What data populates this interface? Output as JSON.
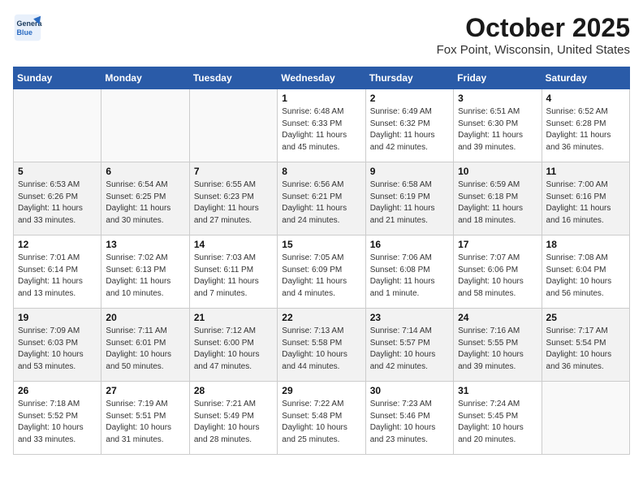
{
  "header": {
    "logo_line1": "General",
    "logo_line2": "Blue",
    "month_title": "October 2025",
    "location": "Fox Point, Wisconsin, United States"
  },
  "days_of_week": [
    "Sunday",
    "Monday",
    "Tuesday",
    "Wednesday",
    "Thursday",
    "Friday",
    "Saturday"
  ],
  "weeks": [
    [
      {
        "day": "",
        "detail": ""
      },
      {
        "day": "",
        "detail": ""
      },
      {
        "day": "",
        "detail": ""
      },
      {
        "day": "1",
        "detail": "Sunrise: 6:48 AM\nSunset: 6:33 PM\nDaylight: 11 hours\nand 45 minutes."
      },
      {
        "day": "2",
        "detail": "Sunrise: 6:49 AM\nSunset: 6:32 PM\nDaylight: 11 hours\nand 42 minutes."
      },
      {
        "day": "3",
        "detail": "Sunrise: 6:51 AM\nSunset: 6:30 PM\nDaylight: 11 hours\nand 39 minutes."
      },
      {
        "day": "4",
        "detail": "Sunrise: 6:52 AM\nSunset: 6:28 PM\nDaylight: 11 hours\nand 36 minutes."
      }
    ],
    [
      {
        "day": "5",
        "detail": "Sunrise: 6:53 AM\nSunset: 6:26 PM\nDaylight: 11 hours\nand 33 minutes."
      },
      {
        "day": "6",
        "detail": "Sunrise: 6:54 AM\nSunset: 6:25 PM\nDaylight: 11 hours\nand 30 minutes."
      },
      {
        "day": "7",
        "detail": "Sunrise: 6:55 AM\nSunset: 6:23 PM\nDaylight: 11 hours\nand 27 minutes."
      },
      {
        "day": "8",
        "detail": "Sunrise: 6:56 AM\nSunset: 6:21 PM\nDaylight: 11 hours\nand 24 minutes."
      },
      {
        "day": "9",
        "detail": "Sunrise: 6:58 AM\nSunset: 6:19 PM\nDaylight: 11 hours\nand 21 minutes."
      },
      {
        "day": "10",
        "detail": "Sunrise: 6:59 AM\nSunset: 6:18 PM\nDaylight: 11 hours\nand 18 minutes."
      },
      {
        "day": "11",
        "detail": "Sunrise: 7:00 AM\nSunset: 6:16 PM\nDaylight: 11 hours\nand 16 minutes."
      }
    ],
    [
      {
        "day": "12",
        "detail": "Sunrise: 7:01 AM\nSunset: 6:14 PM\nDaylight: 11 hours\nand 13 minutes."
      },
      {
        "day": "13",
        "detail": "Sunrise: 7:02 AM\nSunset: 6:13 PM\nDaylight: 11 hours\nand 10 minutes."
      },
      {
        "day": "14",
        "detail": "Sunrise: 7:03 AM\nSunset: 6:11 PM\nDaylight: 11 hours\nand 7 minutes."
      },
      {
        "day": "15",
        "detail": "Sunrise: 7:05 AM\nSunset: 6:09 PM\nDaylight: 11 hours\nand 4 minutes."
      },
      {
        "day": "16",
        "detail": "Sunrise: 7:06 AM\nSunset: 6:08 PM\nDaylight: 11 hours\nand 1 minute."
      },
      {
        "day": "17",
        "detail": "Sunrise: 7:07 AM\nSunset: 6:06 PM\nDaylight: 10 hours\nand 58 minutes."
      },
      {
        "day": "18",
        "detail": "Sunrise: 7:08 AM\nSunset: 6:04 PM\nDaylight: 10 hours\nand 56 minutes."
      }
    ],
    [
      {
        "day": "19",
        "detail": "Sunrise: 7:09 AM\nSunset: 6:03 PM\nDaylight: 10 hours\nand 53 minutes."
      },
      {
        "day": "20",
        "detail": "Sunrise: 7:11 AM\nSunset: 6:01 PM\nDaylight: 10 hours\nand 50 minutes."
      },
      {
        "day": "21",
        "detail": "Sunrise: 7:12 AM\nSunset: 6:00 PM\nDaylight: 10 hours\nand 47 minutes."
      },
      {
        "day": "22",
        "detail": "Sunrise: 7:13 AM\nSunset: 5:58 PM\nDaylight: 10 hours\nand 44 minutes."
      },
      {
        "day": "23",
        "detail": "Sunrise: 7:14 AM\nSunset: 5:57 PM\nDaylight: 10 hours\nand 42 minutes."
      },
      {
        "day": "24",
        "detail": "Sunrise: 7:16 AM\nSunset: 5:55 PM\nDaylight: 10 hours\nand 39 minutes."
      },
      {
        "day": "25",
        "detail": "Sunrise: 7:17 AM\nSunset: 5:54 PM\nDaylight: 10 hours\nand 36 minutes."
      }
    ],
    [
      {
        "day": "26",
        "detail": "Sunrise: 7:18 AM\nSunset: 5:52 PM\nDaylight: 10 hours\nand 33 minutes."
      },
      {
        "day": "27",
        "detail": "Sunrise: 7:19 AM\nSunset: 5:51 PM\nDaylight: 10 hours\nand 31 minutes."
      },
      {
        "day": "28",
        "detail": "Sunrise: 7:21 AM\nSunset: 5:49 PM\nDaylight: 10 hours\nand 28 minutes."
      },
      {
        "day": "29",
        "detail": "Sunrise: 7:22 AM\nSunset: 5:48 PM\nDaylight: 10 hours\nand 25 minutes."
      },
      {
        "day": "30",
        "detail": "Sunrise: 7:23 AM\nSunset: 5:46 PM\nDaylight: 10 hours\nand 23 minutes."
      },
      {
        "day": "31",
        "detail": "Sunrise: 7:24 AM\nSunset: 5:45 PM\nDaylight: 10 hours\nand 20 minutes."
      },
      {
        "day": "",
        "detail": ""
      }
    ]
  ]
}
